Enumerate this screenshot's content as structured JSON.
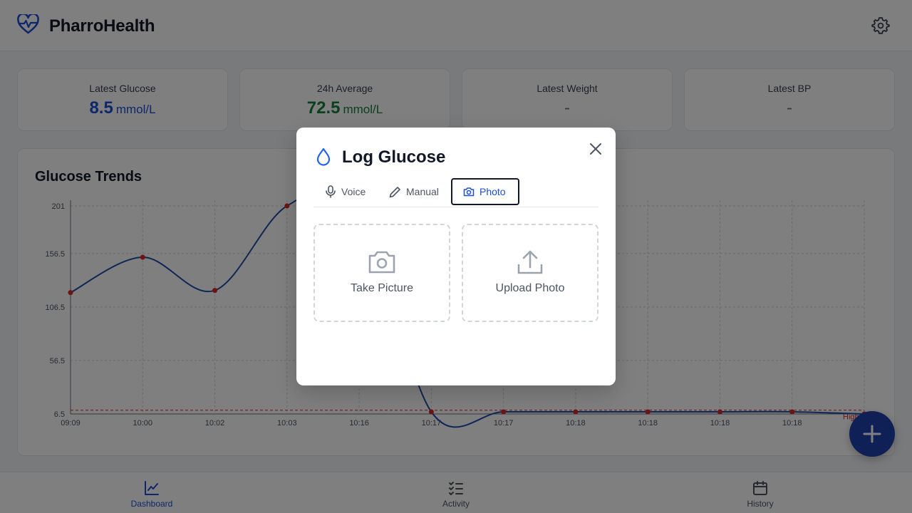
{
  "app": {
    "name": "PharroHealth",
    "accent": "#1d4ed8",
    "brand_icon": "heart-pulse-icon",
    "settings_icon": "gear-icon"
  },
  "stats": [
    {
      "label": "Latest Glucose",
      "value": "8.5",
      "unit": "mmol/L",
      "color": "#1d4ed8"
    },
    {
      "label": "24h Average",
      "value": "72.5",
      "unit": "mmol/L",
      "color": "#15803d"
    },
    {
      "label": "Latest Weight",
      "value": "-"
    },
    {
      "label": "Latest BP",
      "value": "-"
    }
  ],
  "trends": {
    "title": "Glucose Trends",
    "threshold_label": "High"
  },
  "chart_data": {
    "type": "line",
    "title": "Glucose Trends",
    "x": [
      "09:09",
      "10:00",
      "10:02",
      "10:03",
      "10:16",
      "10:17",
      "10:17",
      "10:18",
      "10:18",
      "10:18",
      "10:18",
      "10:19"
    ],
    "x_tick_labels": [
      "09:09",
      "10:00",
      "10:02",
      "10:03",
      "10:16",
      "10:17",
      "10:17",
      "10:18",
      "10:18",
      "10:18",
      "10:18"
    ],
    "values": [
      120,
      153,
      122,
      201,
      201,
      8.5,
      8.5,
      8.5,
      8.5,
      8.5,
      8.5,
      6.5
    ],
    "y_ticks": [
      6.5,
      56.5,
      106.5,
      156.5,
      201
    ],
    "ylim": [
      6.5,
      201
    ],
    "threshold": 10,
    "line_color": "#1e4fa8",
    "point_color": "#dc2626",
    "threshold_color": "#dc2626",
    "grid": true
  },
  "nav": [
    {
      "label": "Dashboard",
      "icon": "line-chart-icon",
      "active": true
    },
    {
      "label": "Activity",
      "icon": "checklist-icon",
      "active": false
    },
    {
      "label": "History",
      "icon": "calendar-icon",
      "active": false
    }
  ],
  "fab": {
    "icon": "plus-icon"
  },
  "modal": {
    "title": "Log Glucose",
    "icon": "droplet-icon",
    "tabs": [
      {
        "label": "Voice",
        "icon": "microphone-icon"
      },
      {
        "label": "Manual",
        "icon": "pencil-icon"
      },
      {
        "label": "Photo",
        "icon": "camera-icon",
        "active": true
      }
    ],
    "options": [
      {
        "label": "Take Picture",
        "icon": "camera-icon"
      },
      {
        "label": "Upload Photo",
        "icon": "upload-icon"
      }
    ]
  }
}
